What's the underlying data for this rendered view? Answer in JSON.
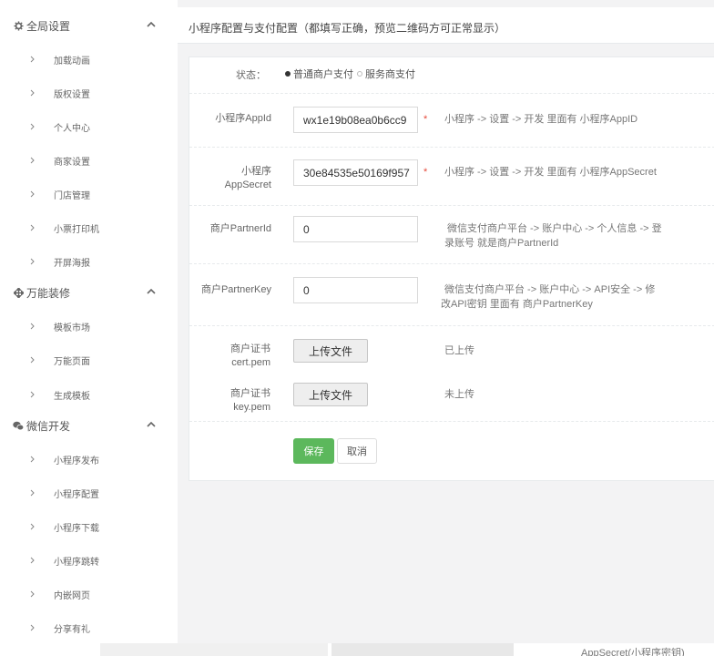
{
  "sidebar": {
    "groups": [
      {
        "label": "全局设置",
        "icon": "gear-icon"
      },
      {
        "label": "万能装修",
        "icon": "move-icon"
      },
      {
        "label": "微信开发",
        "icon": "wechat-icon"
      }
    ],
    "items": [
      {
        "label": "加载动画"
      },
      {
        "label": "版权设置"
      },
      {
        "label": "个人中心"
      },
      {
        "label": "商家设置"
      },
      {
        "label": "门店管理"
      },
      {
        "label": "小票打印机"
      },
      {
        "label": "开屏海报"
      },
      {
        "label": "模板市场"
      },
      {
        "label": "万能页面"
      },
      {
        "label": "生成模板"
      },
      {
        "label": "小程序发布"
      },
      {
        "label": "小程序配置"
      },
      {
        "label": "小程序下载"
      },
      {
        "label": "小程序跳转"
      },
      {
        "label": "内嵌网页"
      },
      {
        "label": "分享有礼"
      }
    ]
  },
  "main": {
    "title": "小程序配置与支付配置（都填写正确，预览二维码方可正常显示）"
  },
  "form": {
    "status": {
      "label": "状态：",
      "options": [
        {
          "label": "普通商户支付",
          "selected": true
        },
        {
          "label": "服务商支付",
          "selected": false
        }
      ]
    },
    "appid": {
      "label": "小程序AppId",
      "value": "wx1e19b08ea0b6cc9",
      "required": "*",
      "hint": "小程序 -> 设置 -> 开发 里面有 小程序AppID"
    },
    "appsecret": {
      "label_line1": "小程序",
      "label_line2": "AppSecret",
      "value": "30e84535e50169f957",
      "required": "*",
      "hint": "小程序 -> 设置 -> 开发 里面有 小程序AppSecret"
    },
    "partnerid": {
      "label": "商户PartnerId",
      "value": "0",
      "hint_line1": "微信支付商户平台 -> 账户中心 -> 个人信息 -> 登",
      "hint_line2": "录账号 就是商户PartnerId"
    },
    "partnerkey": {
      "label": "商户PartnerKey",
      "value": "0",
      "hint_line1": "微信支付商户平台 -> 账户中心 -> API安全 -> 修",
      "hint_line2": "改API密钥 里面有 商户PartnerKey"
    },
    "cert": {
      "label_line1": "商户证书",
      "label_line2": "cert.pem",
      "button": "上传文件",
      "status": "已上传"
    },
    "key": {
      "label_line1": "商户证书",
      "label_line2": "key.pem",
      "button": "上传文件",
      "status": "未上传"
    },
    "save": "保存",
    "cancel": "取消"
  },
  "bottom": {
    "text": "AppSecret(小程序密钥)"
  },
  "colors": {
    "save_button": "#5cb85c",
    "required": "#e64a3b",
    "background": "#f3f3f4"
  }
}
